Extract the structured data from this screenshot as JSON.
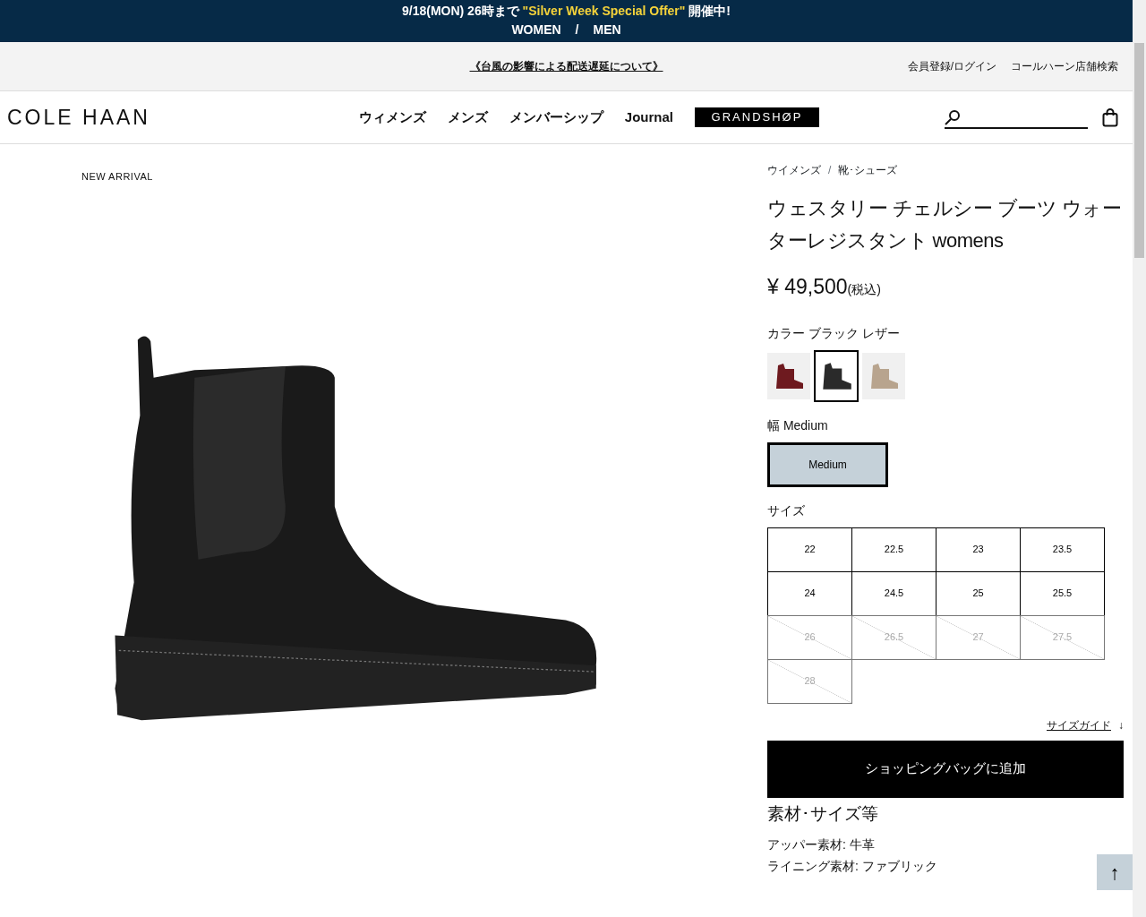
{
  "promo_banner": {
    "date_text": "9/18(MON) 26時まで",
    "offer": "\"Silver Week Special Offer\"",
    "suffix": "開催中!",
    "links": [
      "WOMEN",
      "MEN"
    ],
    "separator": "/"
  },
  "utility_bar": {
    "notice": "《台風の影響による配送遅延について》",
    "links": [
      "会員登録/ログイン",
      "コールハーン店舗検索"
    ]
  },
  "header": {
    "logo": "COLE HAAN",
    "nav": [
      "ウィメンズ",
      "メンズ",
      "メンバーシップ",
      "Journal"
    ],
    "grandshop": "GRANDSHØP"
  },
  "product": {
    "badge": "NEW ARRIVAL",
    "breadcrumbs": [
      "ウイメンズ",
      "靴･シューズ"
    ],
    "breadcrumb_separator": "/",
    "title": "ウェスタリー チェルシー ブーツ ウォーターレジスタント womens",
    "price": "¥ 49,500",
    "tax_note": "(税込)",
    "color_label": "カラー ブラック レザー",
    "swatches": [
      {
        "color": "#6e1a1f",
        "selected": false
      },
      {
        "color": "#2a2a2a",
        "selected": true
      },
      {
        "color": "#b8a48e",
        "selected": false
      }
    ],
    "width_label": "幅 Medium",
    "widths": [
      {
        "label": "Medium",
        "selected": true
      }
    ],
    "size_label": "サイズ",
    "sizes": [
      {
        "label": "22",
        "available": true
      },
      {
        "label": "22.5",
        "available": true
      },
      {
        "label": "23",
        "available": true
      },
      {
        "label": "23.5",
        "available": true
      },
      {
        "label": "24",
        "available": true
      },
      {
        "label": "24.5",
        "available": true
      },
      {
        "label": "25",
        "available": true
      },
      {
        "label": "25.5",
        "available": true
      },
      {
        "label": "26",
        "available": false
      },
      {
        "label": "26.5",
        "available": false
      },
      {
        "label": "27",
        "available": false
      },
      {
        "label": "27.5",
        "available": false
      },
      {
        "label": "28",
        "available": false
      }
    ],
    "size_guide": "サイズガイド",
    "size_guide_arrow": "↓",
    "add_to_bag": "ショッピングバッグに追加",
    "details_heading": "素材･サイズ等",
    "details": [
      "アッパー素材: 牛革",
      "ライニング素材: ファブリック"
    ]
  },
  "back_to_top": "↑"
}
